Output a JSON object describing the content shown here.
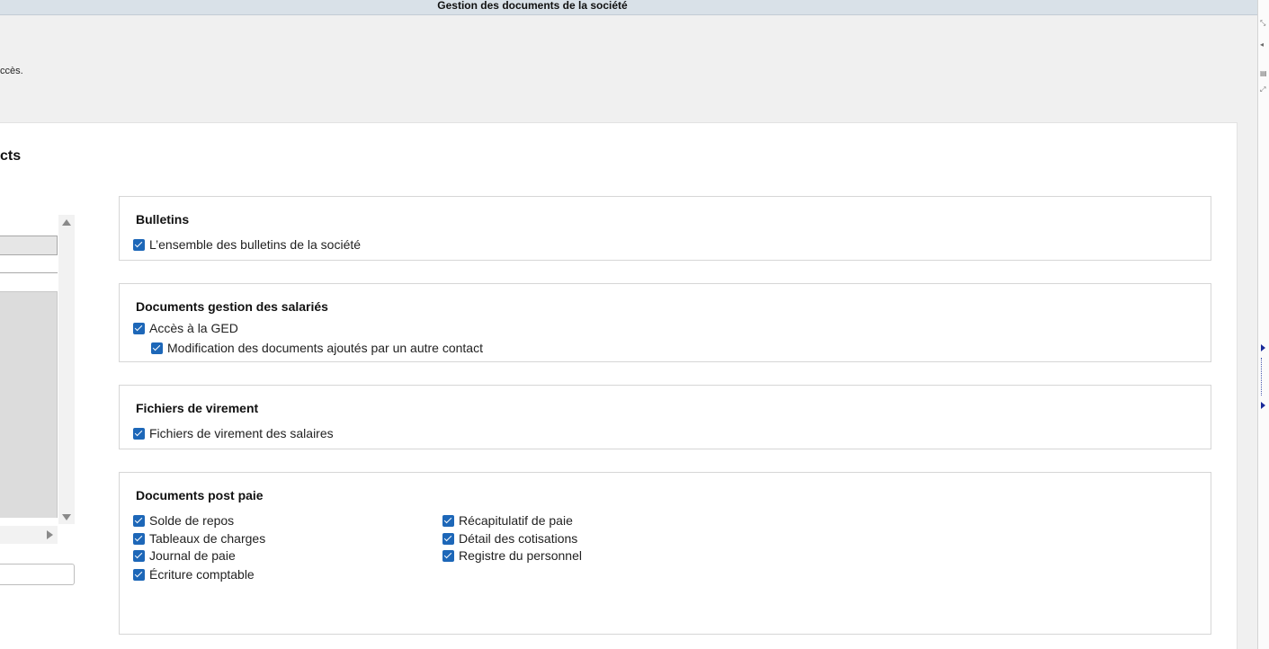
{
  "window": {
    "title": "Gestion des documents de la société"
  },
  "intro": {
    "text": "ccès."
  },
  "panel": {
    "heading": "cts"
  },
  "sections": {
    "bulletins": {
      "title": "Bulletins",
      "items": [
        {
          "label": "L’ensemble des bulletins de la société",
          "checked": true
        }
      ]
    },
    "salaries": {
      "title": "Documents gestion des salariés",
      "items": [
        {
          "label": "Accès à la GED",
          "checked": true
        },
        {
          "label": "Modification des documents ajoutés par un autre contact",
          "checked": true
        }
      ]
    },
    "virement": {
      "title": "Fichiers de virement",
      "items": [
        {
          "label": "Fichiers de virement des salaires",
          "checked": true
        }
      ]
    },
    "postpaie": {
      "title": "Documents post paie",
      "left": [
        {
          "label": "Solde de repos",
          "checked": true
        },
        {
          "label": "Tableaux de charges",
          "checked": true
        },
        {
          "label": "Journal de paie",
          "checked": true
        },
        {
          "label": "Écriture comptable",
          "checked": true
        }
      ],
      "right": [
        {
          "label": "Récapitulatif de paie",
          "checked": true
        },
        {
          "label": "Détail des cotisations",
          "checked": true
        },
        {
          "label": "Registre du personnel",
          "checked": true
        }
      ]
    }
  },
  "colors": {
    "checkbox": "#1d67b8",
    "titlebar": "#d9e1e8",
    "panel_background": "#ffffff",
    "page_background": "#f0f0f0"
  }
}
